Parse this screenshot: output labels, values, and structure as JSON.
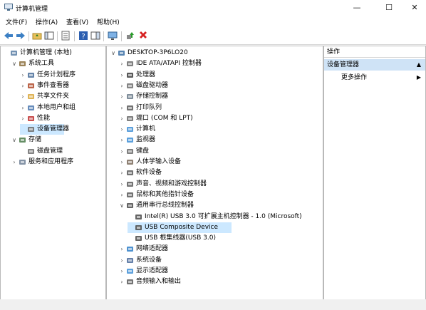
{
  "window": {
    "title": "计算机管理",
    "controls": {
      "minimize": "—",
      "maximize": "☐",
      "close": "✕"
    }
  },
  "menu": [
    "文件(F)",
    "操作(A)",
    "查看(V)",
    "帮助(H)"
  ],
  "toolbar_icons": [
    "back-icon",
    "forward-icon",
    "up-folder-icon",
    "show-hide-tree-icon",
    "properties-icon",
    "help-icon",
    "action-pane-icon",
    "monitor-icon",
    "update-driver-icon",
    "uninstall-icon"
  ],
  "left_tree": [
    {
      "label": "计算机管理 (本地)",
      "icon": "computer-mgmt-icon",
      "level": 0,
      "expander": ""
    },
    {
      "label": "系统工具",
      "icon": "tools-icon",
      "level": 1,
      "expander": "∨"
    },
    {
      "label": "任务计划程序",
      "icon": "clock-icon",
      "level": 2,
      "expander": "›"
    },
    {
      "label": "事件查看器",
      "icon": "event-viewer-icon",
      "level": 2,
      "expander": "›"
    },
    {
      "label": "共享文件夹",
      "icon": "shared-folder-icon",
      "level": 2,
      "expander": "›"
    },
    {
      "label": "本地用户和组",
      "icon": "users-icon",
      "level": 2,
      "expander": "›"
    },
    {
      "label": "性能",
      "icon": "performance-icon",
      "level": 2,
      "expander": "›"
    },
    {
      "label": "设备管理器",
      "icon": "device-manager-icon",
      "level": 2,
      "expander": "",
      "selected": true
    },
    {
      "label": "存储",
      "icon": "storage-icon",
      "level": 1,
      "expander": "∨"
    },
    {
      "label": "磁盘管理",
      "icon": "disk-icon",
      "level": 2,
      "expander": ""
    },
    {
      "label": "服务和应用程序",
      "icon": "services-icon",
      "level": 1,
      "expander": "›"
    }
  ],
  "device_tree": [
    {
      "label": "DESKTOP-3P6LO20",
      "icon": "computer-icon",
      "level": 0,
      "expander": "∨"
    },
    {
      "label": "IDE ATA/ATAPI 控制器",
      "icon": "ide-icon",
      "level": 1,
      "expander": "›"
    },
    {
      "label": "处理器",
      "icon": "cpu-icon",
      "level": 1,
      "expander": "›"
    },
    {
      "label": "磁盘驱动器",
      "icon": "disk-drive-icon",
      "level": 1,
      "expander": "›"
    },
    {
      "label": "存储控制器",
      "icon": "storage-controller-icon",
      "level": 1,
      "expander": "›"
    },
    {
      "label": "打印队列",
      "icon": "printer-icon",
      "level": 1,
      "expander": "›"
    },
    {
      "label": "端口 (COM 和 LPT)",
      "icon": "port-icon",
      "level": 1,
      "expander": "›"
    },
    {
      "label": "计算机",
      "icon": "monitor-icon",
      "level": 1,
      "expander": "›"
    },
    {
      "label": "监视器",
      "icon": "monitor-icon",
      "level": 1,
      "expander": "›"
    },
    {
      "label": "键盘",
      "icon": "keyboard-icon",
      "level": 1,
      "expander": "›"
    },
    {
      "label": "人体学输入设备",
      "icon": "hid-icon",
      "level": 1,
      "expander": "›"
    },
    {
      "label": "软件设备",
      "icon": "software-device-icon",
      "level": 1,
      "expander": "›"
    },
    {
      "label": "声音、视频和游戏控制器",
      "icon": "sound-icon",
      "level": 1,
      "expander": "›"
    },
    {
      "label": "鼠标和其他指针设备",
      "icon": "mouse-icon",
      "level": 1,
      "expander": "›"
    },
    {
      "label": "通用串行总线控制器",
      "icon": "usb-icon",
      "level": 1,
      "expander": "∨"
    },
    {
      "label": "Intel(R) USB 3.0 可扩展主机控制器 - 1.0 (Microsoft)",
      "icon": "usb-device-icon",
      "level": 2,
      "expander": ""
    },
    {
      "label": "USB Composite Device",
      "icon": "usb-device-icon",
      "level": 2,
      "expander": "",
      "selected": true
    },
    {
      "label": "USB 根集线器(USB 3.0)",
      "icon": "usb-device-icon",
      "level": 2,
      "expander": ""
    },
    {
      "label": "网络适配器",
      "icon": "network-icon",
      "level": 1,
      "expander": "›"
    },
    {
      "label": "系统设备",
      "icon": "system-device-icon",
      "level": 1,
      "expander": "›"
    },
    {
      "label": "显示适配器",
      "icon": "display-adapter-icon",
      "level": 1,
      "expander": "›"
    },
    {
      "label": "音频输入和输出",
      "icon": "audio-icon",
      "level": 1,
      "expander": "›"
    }
  ],
  "actions": {
    "header": "操作",
    "section": "设备管理器",
    "section_arrow": "▲",
    "more": "更多操作",
    "more_arrow": "▶"
  }
}
